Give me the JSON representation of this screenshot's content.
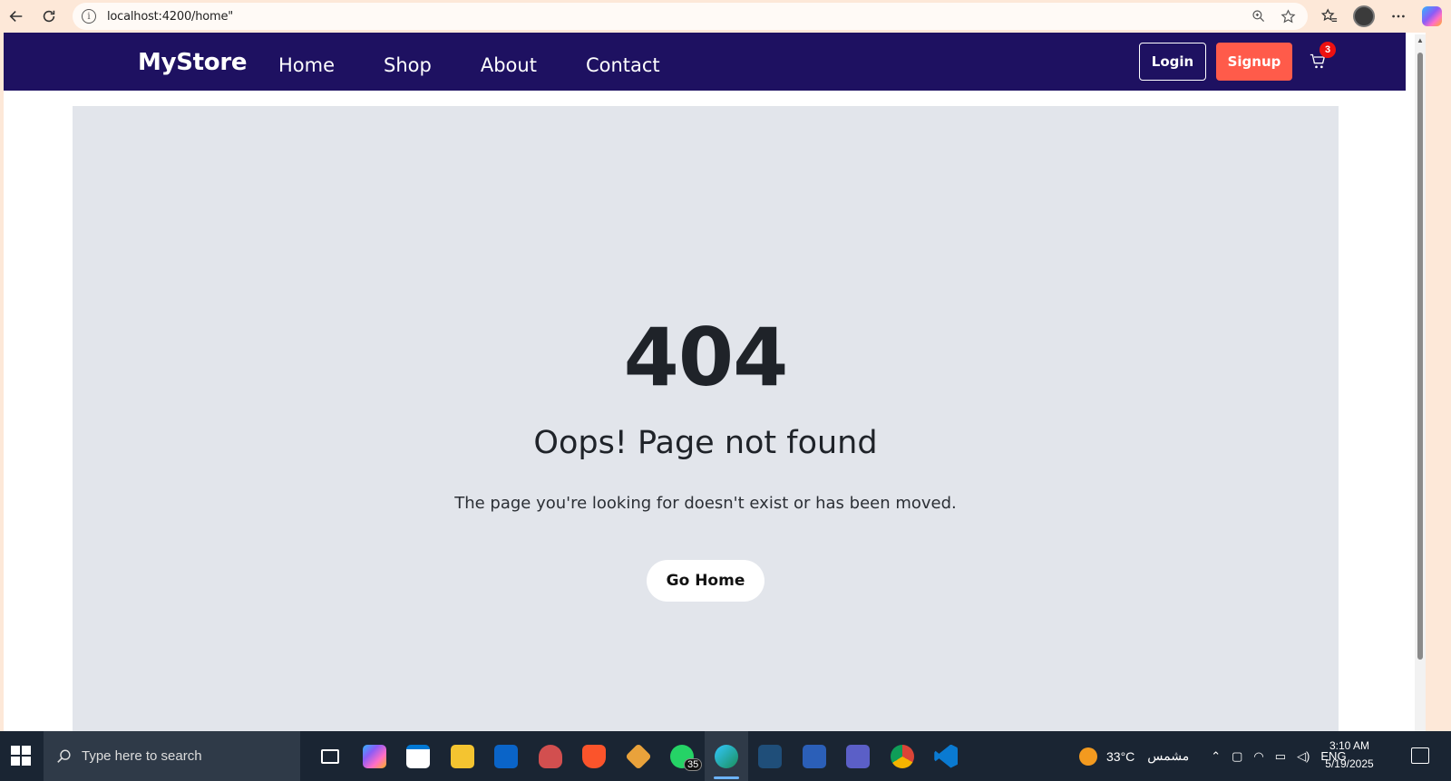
{
  "browser": {
    "url": "localhost:4200/home\"",
    "info_glyph": "i"
  },
  "site": {
    "brand": "MyStore",
    "nav": [
      "Home",
      "Shop",
      "About",
      "Contact"
    ],
    "login_label": "Login",
    "signup_label": "Signup",
    "cart_count": "3"
  },
  "notfound": {
    "code": "404",
    "title": "Oops! Page not found",
    "message": "The page you're looking for doesn't exist or has been moved.",
    "button": "Go Home"
  },
  "taskbar": {
    "search_placeholder": "Type here to search",
    "whatsapp_badge": "35",
    "weather_temp": "33°C",
    "weather_desc": "مشمس",
    "lang": "ENG",
    "time": "3:10 AM",
    "date": "5/19/2025"
  },
  "colors": {
    "navbar": "#1e1161",
    "signup": "#ff5b4a",
    "panel": "#e2e5eb",
    "badge": "#ee1111"
  }
}
